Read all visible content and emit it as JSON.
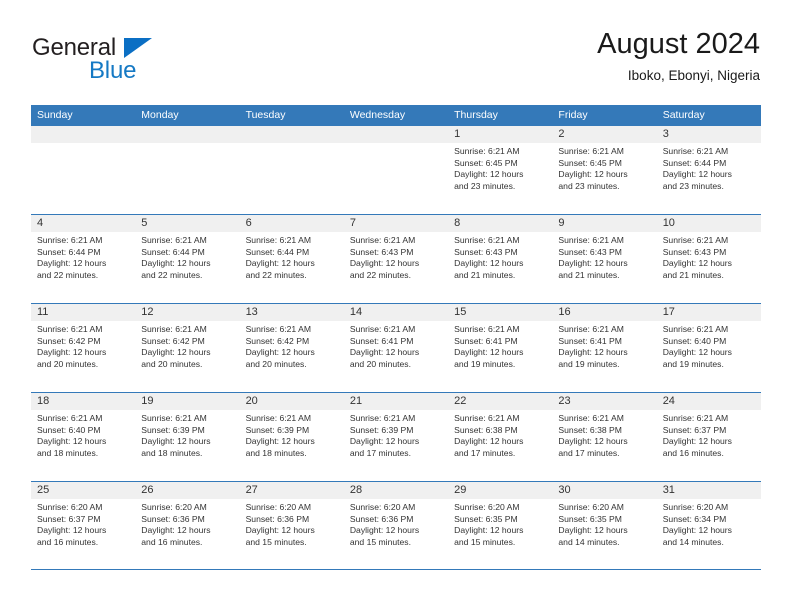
{
  "brand": {
    "name_top": "General",
    "name_bottom": "Blue",
    "accent_color": "#1579c4",
    "triangle_color": "#0b6fc4"
  },
  "header": {
    "title": "August 2024",
    "subtitle": "Iboko, Ebonyi, Nigeria"
  },
  "theme": {
    "header_blue": "#3479b9",
    "date_band": "#f0f0f0",
    "text": "#333333"
  },
  "weekdays": [
    "Sunday",
    "Monday",
    "Tuesday",
    "Wednesday",
    "Thursday",
    "Friday",
    "Saturday"
  ],
  "labels": {
    "sunrise_prefix": "Sunrise:",
    "sunset_prefix": "Sunset:",
    "daylight_prefix": "Daylight:"
  },
  "weeks": [
    [
      {
        "day": "",
        "empty": true
      },
      {
        "day": "",
        "empty": true
      },
      {
        "day": "",
        "empty": true
      },
      {
        "day": "",
        "empty": true
      },
      {
        "day": "1",
        "sunrise": "Sunrise: 6:21 AM",
        "sunset": "Sunset: 6:45 PM",
        "daylight1": "Daylight: 12 hours",
        "daylight2": "and 23 minutes."
      },
      {
        "day": "2",
        "sunrise": "Sunrise: 6:21 AM",
        "sunset": "Sunset: 6:45 PM",
        "daylight1": "Daylight: 12 hours",
        "daylight2": "and 23 minutes."
      },
      {
        "day": "3",
        "sunrise": "Sunrise: 6:21 AM",
        "sunset": "Sunset: 6:44 PM",
        "daylight1": "Daylight: 12 hours",
        "daylight2": "and 23 minutes."
      }
    ],
    [
      {
        "day": "4",
        "sunrise": "Sunrise: 6:21 AM",
        "sunset": "Sunset: 6:44 PM",
        "daylight1": "Daylight: 12 hours",
        "daylight2": "and 22 minutes."
      },
      {
        "day": "5",
        "sunrise": "Sunrise: 6:21 AM",
        "sunset": "Sunset: 6:44 PM",
        "daylight1": "Daylight: 12 hours",
        "daylight2": "and 22 minutes."
      },
      {
        "day": "6",
        "sunrise": "Sunrise: 6:21 AM",
        "sunset": "Sunset: 6:44 PM",
        "daylight1": "Daylight: 12 hours",
        "daylight2": "and 22 minutes."
      },
      {
        "day": "7",
        "sunrise": "Sunrise: 6:21 AM",
        "sunset": "Sunset: 6:43 PM",
        "daylight1": "Daylight: 12 hours",
        "daylight2": "and 22 minutes."
      },
      {
        "day": "8",
        "sunrise": "Sunrise: 6:21 AM",
        "sunset": "Sunset: 6:43 PM",
        "daylight1": "Daylight: 12 hours",
        "daylight2": "and 21 minutes."
      },
      {
        "day": "9",
        "sunrise": "Sunrise: 6:21 AM",
        "sunset": "Sunset: 6:43 PM",
        "daylight1": "Daylight: 12 hours",
        "daylight2": "and 21 minutes."
      },
      {
        "day": "10",
        "sunrise": "Sunrise: 6:21 AM",
        "sunset": "Sunset: 6:43 PM",
        "daylight1": "Daylight: 12 hours",
        "daylight2": "and 21 minutes."
      }
    ],
    [
      {
        "day": "11",
        "sunrise": "Sunrise: 6:21 AM",
        "sunset": "Sunset: 6:42 PM",
        "daylight1": "Daylight: 12 hours",
        "daylight2": "and 20 minutes."
      },
      {
        "day": "12",
        "sunrise": "Sunrise: 6:21 AM",
        "sunset": "Sunset: 6:42 PM",
        "daylight1": "Daylight: 12 hours",
        "daylight2": "and 20 minutes."
      },
      {
        "day": "13",
        "sunrise": "Sunrise: 6:21 AM",
        "sunset": "Sunset: 6:42 PM",
        "daylight1": "Daylight: 12 hours",
        "daylight2": "and 20 minutes."
      },
      {
        "day": "14",
        "sunrise": "Sunrise: 6:21 AM",
        "sunset": "Sunset: 6:41 PM",
        "daylight1": "Daylight: 12 hours",
        "daylight2": "and 20 minutes."
      },
      {
        "day": "15",
        "sunrise": "Sunrise: 6:21 AM",
        "sunset": "Sunset: 6:41 PM",
        "daylight1": "Daylight: 12 hours",
        "daylight2": "and 19 minutes."
      },
      {
        "day": "16",
        "sunrise": "Sunrise: 6:21 AM",
        "sunset": "Sunset: 6:41 PM",
        "daylight1": "Daylight: 12 hours",
        "daylight2": "and 19 minutes."
      },
      {
        "day": "17",
        "sunrise": "Sunrise: 6:21 AM",
        "sunset": "Sunset: 6:40 PM",
        "daylight1": "Daylight: 12 hours",
        "daylight2": "and 19 minutes."
      }
    ],
    [
      {
        "day": "18",
        "sunrise": "Sunrise: 6:21 AM",
        "sunset": "Sunset: 6:40 PM",
        "daylight1": "Daylight: 12 hours",
        "daylight2": "and 18 minutes."
      },
      {
        "day": "19",
        "sunrise": "Sunrise: 6:21 AM",
        "sunset": "Sunset: 6:39 PM",
        "daylight1": "Daylight: 12 hours",
        "daylight2": "and 18 minutes."
      },
      {
        "day": "20",
        "sunrise": "Sunrise: 6:21 AM",
        "sunset": "Sunset: 6:39 PM",
        "daylight1": "Daylight: 12 hours",
        "daylight2": "and 18 minutes."
      },
      {
        "day": "21",
        "sunrise": "Sunrise: 6:21 AM",
        "sunset": "Sunset: 6:39 PM",
        "daylight1": "Daylight: 12 hours",
        "daylight2": "and 17 minutes."
      },
      {
        "day": "22",
        "sunrise": "Sunrise: 6:21 AM",
        "sunset": "Sunset: 6:38 PM",
        "daylight1": "Daylight: 12 hours",
        "daylight2": "and 17 minutes."
      },
      {
        "day": "23",
        "sunrise": "Sunrise: 6:21 AM",
        "sunset": "Sunset: 6:38 PM",
        "daylight1": "Daylight: 12 hours",
        "daylight2": "and 17 minutes."
      },
      {
        "day": "24",
        "sunrise": "Sunrise: 6:21 AM",
        "sunset": "Sunset: 6:37 PM",
        "daylight1": "Daylight: 12 hours",
        "daylight2": "and 16 minutes."
      }
    ],
    [
      {
        "day": "25",
        "sunrise": "Sunrise: 6:20 AM",
        "sunset": "Sunset: 6:37 PM",
        "daylight1": "Daylight: 12 hours",
        "daylight2": "and 16 minutes."
      },
      {
        "day": "26",
        "sunrise": "Sunrise: 6:20 AM",
        "sunset": "Sunset: 6:36 PM",
        "daylight1": "Daylight: 12 hours",
        "daylight2": "and 16 minutes."
      },
      {
        "day": "27",
        "sunrise": "Sunrise: 6:20 AM",
        "sunset": "Sunset: 6:36 PM",
        "daylight1": "Daylight: 12 hours",
        "daylight2": "and 15 minutes."
      },
      {
        "day": "28",
        "sunrise": "Sunrise: 6:20 AM",
        "sunset": "Sunset: 6:36 PM",
        "daylight1": "Daylight: 12 hours",
        "daylight2": "and 15 minutes."
      },
      {
        "day": "29",
        "sunrise": "Sunrise: 6:20 AM",
        "sunset": "Sunset: 6:35 PM",
        "daylight1": "Daylight: 12 hours",
        "daylight2": "and 15 minutes."
      },
      {
        "day": "30",
        "sunrise": "Sunrise: 6:20 AM",
        "sunset": "Sunset: 6:35 PM",
        "daylight1": "Daylight: 12 hours",
        "daylight2": "and 14 minutes."
      },
      {
        "day": "31",
        "sunrise": "Sunrise: 6:20 AM",
        "sunset": "Sunset: 6:34 PM",
        "daylight1": "Daylight: 12 hours",
        "daylight2": "and 14 minutes."
      }
    ]
  ]
}
